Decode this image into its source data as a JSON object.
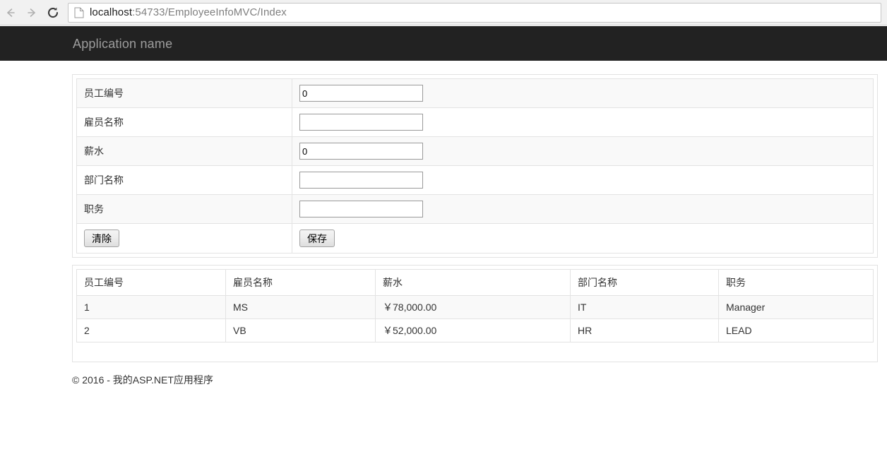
{
  "browser": {
    "back_icon": "arrow-left-icon",
    "forward_icon": "arrow-right-icon",
    "reload_icon": "reload-icon",
    "page_icon": "page-document-icon",
    "url_host": "localhost",
    "url_path": ":54733/EmployeeInfoMVC/Index",
    "url_full": "localhost:54733/EmployeeInfoMVC/Index"
  },
  "navbar": {
    "brand": "Application name",
    "background": "#222222",
    "text_color": "#9d9d9d"
  },
  "form": {
    "rows": [
      {
        "label": "员工编号",
        "value": "0",
        "placeholder": "",
        "type": "text"
      },
      {
        "label": "雇员名称",
        "value": "",
        "placeholder": "",
        "type": "text"
      },
      {
        "label": "薪水",
        "value": "0",
        "placeholder": "",
        "type": "text"
      },
      {
        "label": "部门名称",
        "value": "",
        "placeholder": "",
        "type": "text"
      },
      {
        "label": "职务",
        "value": "",
        "placeholder": "",
        "type": "text"
      }
    ],
    "clear_button": "清除",
    "save_button": "保存"
  },
  "data_table": {
    "headers": [
      "员工编号",
      "雇员名称",
      "薪水",
      "部门名称",
      "职务"
    ],
    "rows": [
      {
        "id": "1",
        "name": "MS",
        "salary": "￥78,000.00",
        "dept": "IT",
        "title": "Manager"
      },
      {
        "id": "2",
        "name": "VB",
        "salary": "￥52,000.00",
        "dept": "HR",
        "title": "LEAD"
      }
    ]
  },
  "footer": {
    "text": "© 2016 - 我的ASP.NET应用程序"
  }
}
